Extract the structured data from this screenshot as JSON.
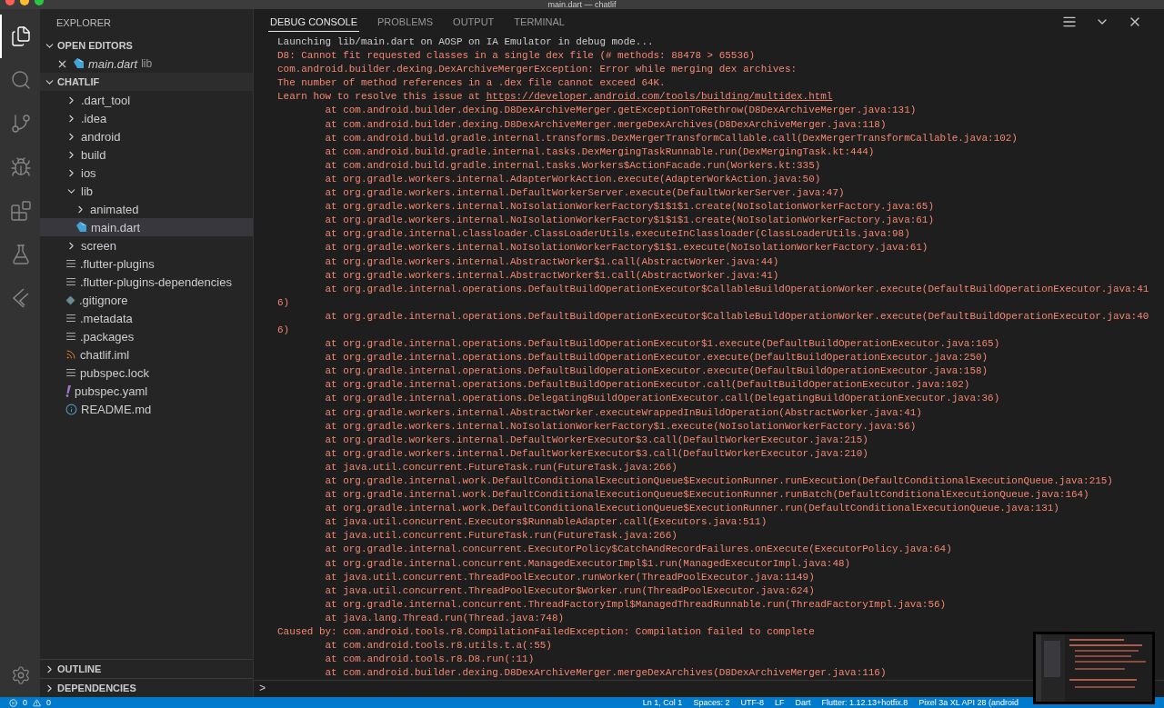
{
  "window": {
    "title": "main.dart — chatlif"
  },
  "activity_bar": [
    {
      "kind": "files",
      "selected": true
    },
    {
      "kind": "search",
      "selected": false
    },
    {
      "kind": "scm",
      "selected": false
    },
    {
      "kind": "debug",
      "selected": false
    },
    {
      "kind": "extensions",
      "selected": false
    },
    {
      "kind": "testing",
      "selected": false
    },
    {
      "kind": "flutter",
      "selected": false
    }
  ],
  "sidebar": {
    "title": "EXPLORER",
    "open_editors": {
      "label": "OPEN EDITORS",
      "expanded": true,
      "items": [
        {
          "name": "main.dart",
          "folder": "lib",
          "kind": "dart"
        }
      ]
    },
    "project": {
      "label": "CHATLIF",
      "expanded": true,
      "items": [
        {
          "name": ".dart_tool",
          "kind": "folder",
          "expanded": false,
          "selected": false
        },
        {
          "name": ".idea",
          "kind": "folder",
          "expanded": false,
          "selected": false
        },
        {
          "name": "android",
          "kind": "folder",
          "expanded": false,
          "selected": false
        },
        {
          "name": "build",
          "kind": "folder",
          "expanded": false,
          "selected": false
        },
        {
          "name": "ios",
          "kind": "folder",
          "expanded": false,
          "selected": false
        },
        {
          "name": "lib",
          "kind": "folder",
          "expanded": true,
          "selected": false,
          "children": [
            {
              "name": "animated",
              "kind": "folder",
              "expanded": false,
              "selected": false
            },
            {
              "name": "main.dart",
              "kind": "dart",
              "selected": true
            }
          ]
        },
        {
          "name": "screen",
          "kind": "folder",
          "expanded": false,
          "selected": false
        },
        {
          "name": ".flutter-plugins",
          "kind": "text",
          "selected": false
        },
        {
          "name": ".flutter-plugins-dependencies",
          "kind": "text",
          "selected": false
        },
        {
          "name": ".gitignore",
          "kind": "git",
          "selected": false
        },
        {
          "name": ".metadata",
          "kind": "text",
          "selected": false
        },
        {
          "name": ".packages",
          "kind": "text",
          "selected": false
        },
        {
          "name": "chatlif.iml",
          "kind": "feed",
          "selected": false
        },
        {
          "name": "pubspec.lock",
          "kind": "text",
          "selected": false
        },
        {
          "name": "pubspec.yaml",
          "kind": "yaml",
          "selected": false
        },
        {
          "name": "README.md",
          "kind": "info",
          "selected": false
        }
      ]
    },
    "bottom_sections": [
      {
        "label": "OUTLINE",
        "expanded": false
      },
      {
        "label": "DEPENDENCIES",
        "expanded": false
      }
    ]
  },
  "panel": {
    "tabs": [
      {
        "label": "DEBUG CONSOLE",
        "selected": true
      },
      {
        "label": "PROBLEMS",
        "selected": false
      },
      {
        "label": "OUTPUT",
        "selected": false
      },
      {
        "label": "TERMINAL",
        "selected": false
      }
    ],
    "console": [
      {
        "kind": "info",
        "text": "Launching lib/main.dart on AOSP on IA Emulator in debug mode..."
      },
      {
        "kind": "error",
        "text": "D8: Cannot fit requested classes in a single dex file (# methods: 88478 > 65536)"
      },
      {
        "kind": "error",
        "text": "com.android.builder.dexing.DexArchiveMergerException: Error while merging dex archives:"
      },
      {
        "kind": "error",
        "text": "The number of method references in a .dex file cannot exceed 64K."
      },
      {
        "kind": "link",
        "text": "Learn how to resolve this issue at ",
        "link": "https://developer.android.com/tools/building/multidex.html"
      },
      {
        "kind": "error",
        "text": "        at com.android.builder.dexing.D8DexArchiveMerger.getExceptionToRethrow(D8DexArchiveMerger.java:131)"
      },
      {
        "kind": "error",
        "text": "        at com.android.builder.dexing.D8DexArchiveMerger.mergeDexArchives(D8DexArchiveMerger.java:118)"
      },
      {
        "kind": "error",
        "text": "        at com.android.build.gradle.internal.transforms.DexMergerTransformCallable.call(DexMergerTransformCallable.java:102)"
      },
      {
        "kind": "error",
        "text": "        at com.android.build.gradle.internal.tasks.DexMergingTaskRunnable.run(DexMergingTask.kt:444)"
      },
      {
        "kind": "error",
        "text": "        at com.android.build.gradle.internal.tasks.Workers$ActionFacade.run(Workers.kt:335)"
      },
      {
        "kind": "error",
        "text": "        at org.gradle.workers.internal.AdapterWorkAction.execute(AdapterWorkAction.java:50)"
      },
      {
        "kind": "error",
        "text": "        at org.gradle.workers.internal.DefaultWorkerServer.execute(DefaultWorkerServer.java:47)"
      },
      {
        "kind": "error",
        "text": "        at org.gradle.workers.internal.NoIsolationWorkerFactory$1$1$1.create(NoIsolationWorkerFactory.java:65)"
      },
      {
        "kind": "error",
        "text": "        at org.gradle.workers.internal.NoIsolationWorkerFactory$1$1$1.create(NoIsolationWorkerFactory.java:61)"
      },
      {
        "kind": "error",
        "text": "        at org.gradle.internal.classloader.ClassLoaderUtils.executeInClassloader(ClassLoaderUtils.java:98)"
      },
      {
        "kind": "error",
        "text": "        at org.gradle.workers.internal.NoIsolationWorkerFactory$1$1.execute(NoIsolationWorkerFactory.java:61)"
      },
      {
        "kind": "error",
        "text": "        at org.gradle.workers.internal.AbstractWorker$1.call(AbstractWorker.java:44)"
      },
      {
        "kind": "error",
        "text": "        at org.gradle.workers.internal.AbstractWorker$1.call(AbstractWorker.java:41)"
      },
      {
        "kind": "error",
        "text": "        at org.gradle.internal.operations.DefaultBuildOperationExecutor$CallableBuildOperationWorker.execute(DefaultBuildOperationExecutor.java:416)"
      },
      {
        "kind": "error",
        "text": "        at org.gradle.internal.operations.DefaultBuildOperationExecutor$CallableBuildOperationWorker.execute(DefaultBuildOperationExecutor.java:406)"
      },
      {
        "kind": "error",
        "text": "        at org.gradle.internal.operations.DefaultBuildOperationExecutor$1.execute(DefaultBuildOperationExecutor.java:165)"
      },
      {
        "kind": "error",
        "text": "        at org.gradle.internal.operations.DefaultBuildOperationExecutor.execute(DefaultBuildOperationExecutor.java:250)"
      },
      {
        "kind": "error",
        "text": "        at org.gradle.internal.operations.DefaultBuildOperationExecutor.execute(DefaultBuildOperationExecutor.java:158)"
      },
      {
        "kind": "error",
        "text": "        at org.gradle.internal.operations.DefaultBuildOperationExecutor.call(DefaultBuildOperationExecutor.java:102)"
      },
      {
        "kind": "error",
        "text": "        at org.gradle.internal.operations.DelegatingBuildOperationExecutor.call(DelegatingBuildOperationExecutor.java:36)"
      },
      {
        "kind": "error",
        "text": "        at org.gradle.workers.internal.AbstractWorker.executeWrappedInBuildOperation(AbstractWorker.java:41)"
      },
      {
        "kind": "error",
        "text": "        at org.gradle.workers.internal.NoIsolationWorkerFactory$1.execute(NoIsolationWorkerFactory.java:56)"
      },
      {
        "kind": "error",
        "text": "        at org.gradle.workers.internal.DefaultWorkerExecutor$3.call(DefaultWorkerExecutor.java:215)"
      },
      {
        "kind": "error",
        "text": "        at org.gradle.workers.internal.DefaultWorkerExecutor$3.call(DefaultWorkerExecutor.java:210)"
      },
      {
        "kind": "error",
        "text": "        at java.util.concurrent.FutureTask.run(FutureTask.java:266)"
      },
      {
        "kind": "error",
        "text": "        at org.gradle.internal.work.DefaultConditionalExecutionQueue$ExecutionRunner.runExecution(DefaultConditionalExecutionQueue.java:215)"
      },
      {
        "kind": "error",
        "text": "        at org.gradle.internal.work.DefaultConditionalExecutionQueue$ExecutionRunner.runBatch(DefaultConditionalExecutionQueue.java:164)"
      },
      {
        "kind": "error",
        "text": "        at org.gradle.internal.work.DefaultConditionalExecutionQueue$ExecutionRunner.run(DefaultConditionalExecutionQueue.java:131)"
      },
      {
        "kind": "error",
        "text": "        at java.util.concurrent.Executors$RunnableAdapter.call(Executors.java:511)"
      },
      {
        "kind": "error",
        "text": "        at java.util.concurrent.FutureTask.run(FutureTask.java:266)"
      },
      {
        "kind": "error",
        "text": "        at org.gradle.internal.concurrent.ExecutorPolicy$CatchAndRecordFailures.onExecute(ExecutorPolicy.java:64)"
      },
      {
        "kind": "error",
        "text": "        at org.gradle.internal.concurrent.ManagedExecutorImpl$1.run(ManagedExecutorImpl.java:48)"
      },
      {
        "kind": "error",
        "text": "        at java.util.concurrent.ThreadPoolExecutor.runWorker(ThreadPoolExecutor.java:1149)"
      },
      {
        "kind": "error",
        "text": "        at java.util.concurrent.ThreadPoolExecutor$Worker.run(ThreadPoolExecutor.java:624)"
      },
      {
        "kind": "error",
        "text": "        at org.gradle.internal.concurrent.ThreadFactoryImpl$ManagedThreadRunnable.run(ThreadFactoryImpl.java:56)"
      },
      {
        "kind": "error",
        "text": "        at java.lang.Thread.run(Thread.java:748)"
      },
      {
        "kind": "error",
        "text": "Caused by: com.android.tools.r8.CompilationFailedException: Compilation failed to complete"
      },
      {
        "kind": "error",
        "text": "        at com.android.tools.r8.utils.t.a(:55)"
      },
      {
        "kind": "error",
        "text": "        at com.android.tools.r8.D8.run(:11)"
      },
      {
        "kind": "error",
        "text": "        at com.android.builder.dexing.D8DexArchiveMerger.mergeDexArchives(D8DexArchiveMerger.java:116)"
      }
    ],
    "prompt": ">"
  },
  "status_bar": {
    "errors": "0",
    "warnings": "0",
    "items": [
      "Ln 1, Col 1",
      "Spaces: 2",
      "UTF-8",
      "LF",
      "Dart",
      "Flutter: 1.12.13+hotfix.8",
      "Pixel 3a XL API 28 (android"
    ]
  }
}
